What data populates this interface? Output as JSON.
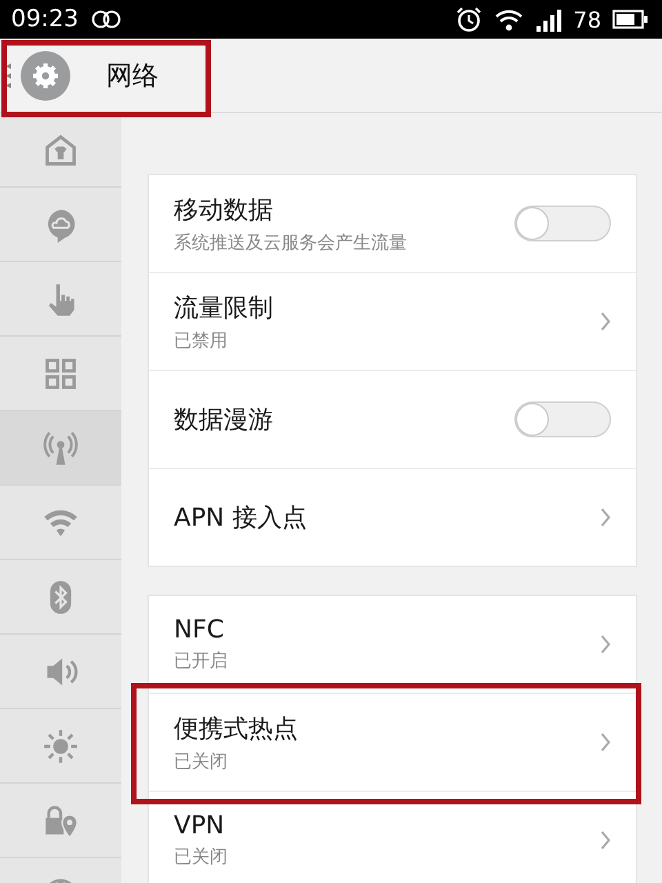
{
  "status_bar": {
    "time": "09:23",
    "battery": "78"
  },
  "header": {
    "title": "网络",
    "highlighted": true
  },
  "sidebar": {
    "items": [
      {
        "selected": false
      },
      {
        "selected": false
      },
      {
        "selected": false
      },
      {
        "selected": false
      },
      {
        "selected": true
      },
      {
        "selected": false
      },
      {
        "selected": false
      },
      {
        "selected": false
      },
      {
        "selected": false
      },
      {
        "selected": false
      },
      {
        "selected": false
      }
    ]
  },
  "groups": [
    {
      "items": [
        {
          "kind": "toggle",
          "title": "移动数据",
          "subtitle": "系统推送及云服务会产生流量",
          "on": false,
          "highlighted": false
        },
        {
          "kind": "link",
          "title": "流量限制",
          "subtitle": "已禁用",
          "highlighted": false
        },
        {
          "kind": "toggle",
          "title": "数据漫游",
          "on": false,
          "highlighted": false
        },
        {
          "kind": "link",
          "title": "APN 接入点",
          "highlighted": false
        }
      ]
    },
    {
      "items": [
        {
          "kind": "link",
          "title": "NFC",
          "subtitle": "已开启",
          "highlighted": false
        },
        {
          "kind": "link",
          "title": "便携式热点",
          "subtitle": "已关闭",
          "highlighted": true
        },
        {
          "kind": "link",
          "title": "VPN",
          "subtitle": "已关闭",
          "highlighted": false
        }
      ]
    }
  ]
}
